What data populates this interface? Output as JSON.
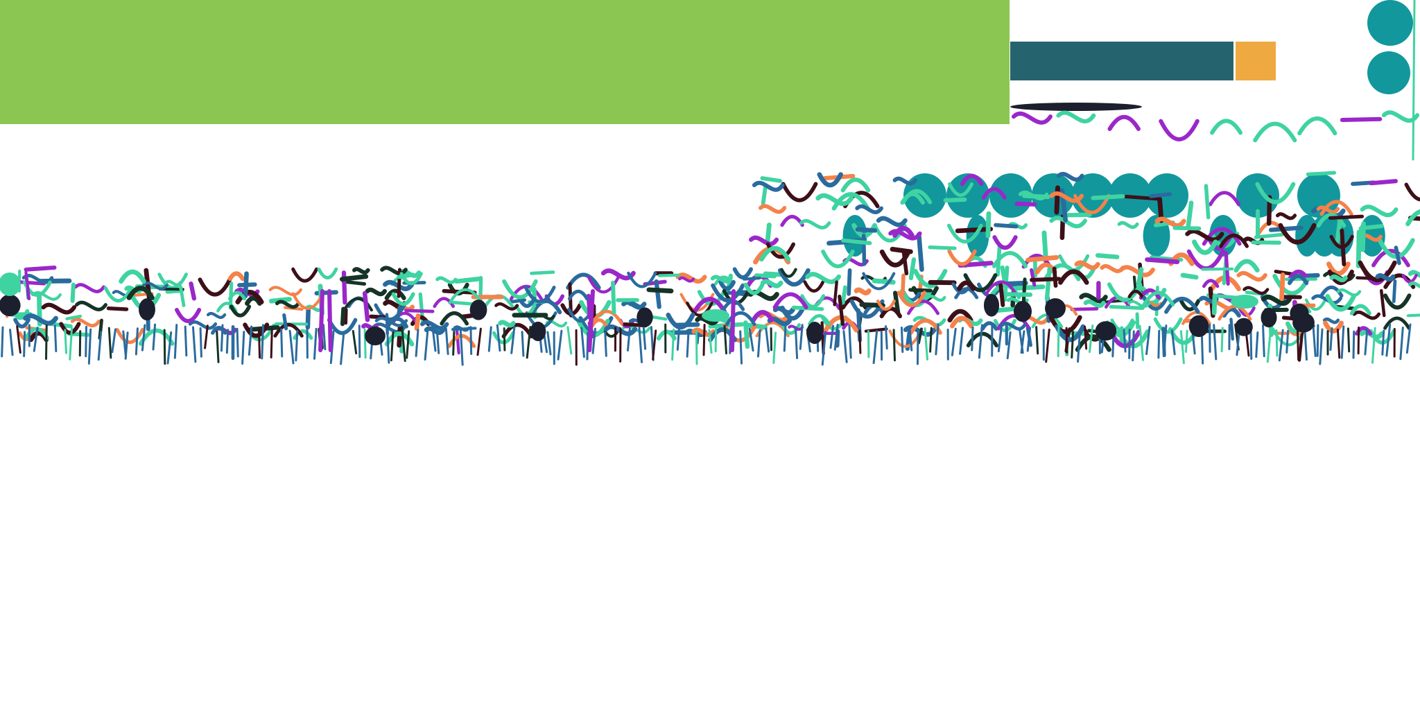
{
  "colors": {
    "background": "#ffffff",
    "band": "#8bc653",
    "chip_dark": "#25646e",
    "chip_orange": "#efa941",
    "mint": "#3fd3a2",
    "teal": "#12979d",
    "orange": "#f4824a",
    "purple": "#9a27c9",
    "blue": "#2a6b9e",
    "navy": "#1b1f2e",
    "maroon": "#3d1018",
    "darkgreen": "#153326"
  },
  "icons": [
    "stroke-glyph",
    "blob-glyph",
    "dot-glyph"
  ]
}
